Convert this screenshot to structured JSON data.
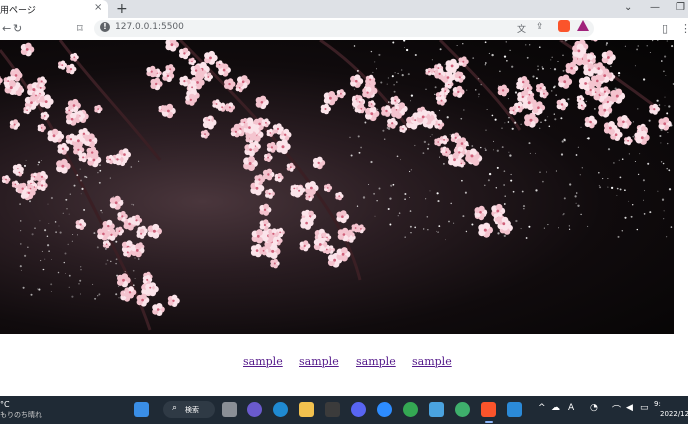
{
  "browser": {
    "tab_title": "用ページ",
    "tab_close": "×",
    "new_tab": "+",
    "url": "127.0.0.1:5500",
    "window_controls": [
      "⌄",
      "—",
      "❐"
    ]
  },
  "toolbar_icons": [
    "back-arrow-icon",
    "reload-icon",
    "bookmark-icon",
    "translate-icon",
    "share-icon",
    "brave-shields-icon",
    "brave-rewards-icon",
    "side-panel-icon"
  ],
  "hero": {
    "theme": "night-cherry-blossoms"
  },
  "links": [
    "sample",
    "sample",
    "sample",
    "sample"
  ],
  "taskbar": {
    "weather_temp": "°C",
    "weather_desc": "もりのち晴れ",
    "search_label": "検索",
    "clock_time": "9:",
    "clock_date": "2022/12/"
  },
  "colors": {
    "link": "#551a8b",
    "taskbar": "#1f2a35",
    "tabstrip": "#dee1e6"
  }
}
